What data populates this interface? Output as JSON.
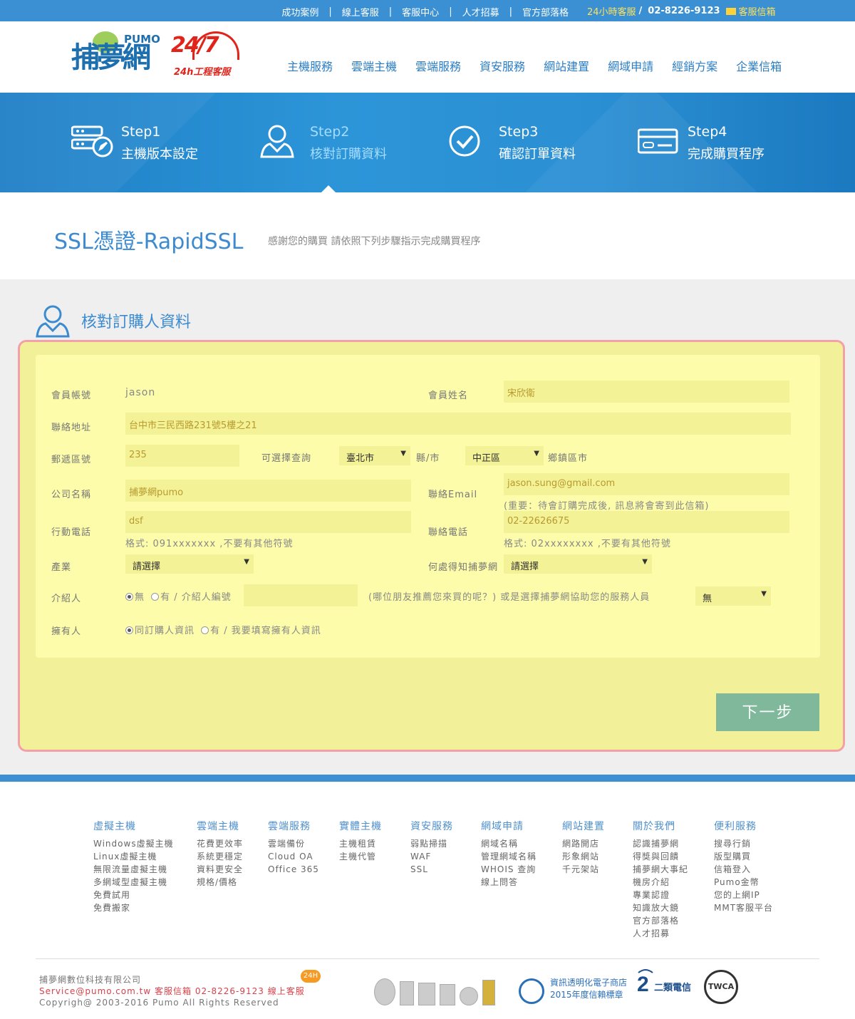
{
  "topbar": {
    "links": [
      "成功案例",
      "線上客服",
      "客服中心",
      "人才招募",
      "官方部落格"
    ],
    "hotline_label": "24小時客服",
    "hotline_sep": "/",
    "phone": "02-8226-9123",
    "mail_label": "客服信箱"
  },
  "header": {
    "logo_text": "捕夢網",
    "logo_en": "PUMO",
    "badge_num": "24/7",
    "badge_text": "24h工程客服",
    "nav": [
      "主機服務",
      "雲端主機",
      "雲端服務",
      "資安服務",
      "網站建置",
      "網域申請",
      "經銷方案",
      "企業信箱"
    ]
  },
  "steps": [
    {
      "num": "Step1",
      "label": "主機版本設定"
    },
    {
      "num": "Step2",
      "label": "核對訂購資料"
    },
    {
      "num": "Step3",
      "label": "確認訂單資料"
    },
    {
      "num": "Step4",
      "label": "完成購買程序"
    }
  ],
  "page": {
    "title": "SSL憑證-RapidSSL",
    "subtitle": "感謝您的購買 請依照下列步驟指示完成購買程序"
  },
  "section": {
    "title": "核對訂購人資料"
  },
  "form": {
    "account_label": "會員帳號",
    "account_value": "jason",
    "name_label": "會員姓名",
    "name_value": "宋欣衛",
    "address_label": "聯絡地址",
    "address_value": "台中市三民西路231號5樓之21",
    "zip_label": "郵遞區號",
    "zip_value": "235",
    "lookup_label": "可選擇查詢",
    "city_value": "臺北市",
    "city_suffix": "縣/市",
    "district_value": "中正區",
    "district_suffix": "鄉鎮區市",
    "company_label": "公司名稱",
    "company_value": "捕夢網pumo",
    "email_label": "聯絡Email",
    "email_value": "jason.sung@gmail.com",
    "email_note": "(重要：待會訂購完成後, 訊息將會寄到此信箱)",
    "mobile_label": "行動電話",
    "mobile_value": "dsf",
    "mobile_note": "格式: 091xxxxxxx ,不要有其他符號",
    "tel_label": "聯絡電話",
    "tel_value": "02-22626675",
    "tel_note": "格式: 02xxxxxxxx ,不要有其他符號",
    "industry_label": "產業",
    "industry_value": "請選擇",
    "source_label": "何處得知捕夢網",
    "source_value": "請選擇",
    "referrer_label": "介紹人",
    "referrer_no": "無",
    "referrer_yes": "有 / 介紹人編號",
    "referrer_note": "(哪位朋友推薦您來買的呢？) 或是選擇捕夢網協助您的服務人員",
    "staff_value": "無",
    "owner_label": "擁有人",
    "owner_same": "同訂購人資訊",
    "owner_other": "有 / 我要填寫擁有人資訊",
    "next_label": "下一步"
  },
  "footer": {
    "columns": [
      {
        "title": "虛擬主機",
        "items": [
          "Windows虛擬主機",
          "Linux虛擬主機",
          "無限流量虛擬主機",
          "多網域型虛擬主機",
          "免費試用",
          "免費搬家"
        ]
      },
      {
        "title": "雲端主機",
        "items": [
          "花費更效率",
          "系統更穩定",
          "資料更安全",
          "規格/價格"
        ]
      },
      {
        "title": "雲端服務",
        "items": [
          "雲端備份",
          "Cloud OA",
          "Office 365"
        ]
      },
      {
        "title": "實體主機",
        "items": [
          "主機租賃",
          "主機代管"
        ]
      },
      {
        "title": "資安服務",
        "items": [
          "弱點掃描",
          "WAF",
          "SSL"
        ]
      },
      {
        "title": "網域申請",
        "items": [
          "網域名稱",
          "管理網域名稱",
          "WHOIS 查詢",
          "線上問答"
        ]
      },
      {
        "title": "網站建置",
        "items": [
          "網路開店",
          "形象網站",
          "千元架站"
        ]
      },
      {
        "title": "關於我們",
        "items": [
          "認識捕夢網",
          "得獎與回饋",
          "捕夢網大事紀",
          "機房介紹",
          "專業認證",
          "知識放大鏡",
          "官方部落格",
          "人才招募"
        ]
      },
      {
        "title": "便利服務",
        "items": [
          "搜尋行銷",
          "版型購買",
          "信箱登入",
          "Pumo金幣",
          "您的上網IP",
          "MMT客服平台"
        ]
      }
    ],
    "company": "捕夢網數位科技有限公司",
    "email": "Service@pumo.com.tw",
    "mail_label": "客服信箱",
    "phone": "02-8226-9123",
    "chat_label": "線上客服",
    "badge_24h": "24H",
    "copyright": "Copyrigh@ 2003-2016 Pumo All Rights Reserved",
    "trust_line1": "資訊透明化電子商店",
    "trust_line2": "2015年度信賴標章",
    "telecom_label": "二類電信",
    "twca_label": "TWCA"
  },
  "colors": {
    "accent": "#3b8fd3",
    "form_bg": "#fcfcaa",
    "frame_border": "#f4a0a8",
    "button": "#7fb89a"
  }
}
